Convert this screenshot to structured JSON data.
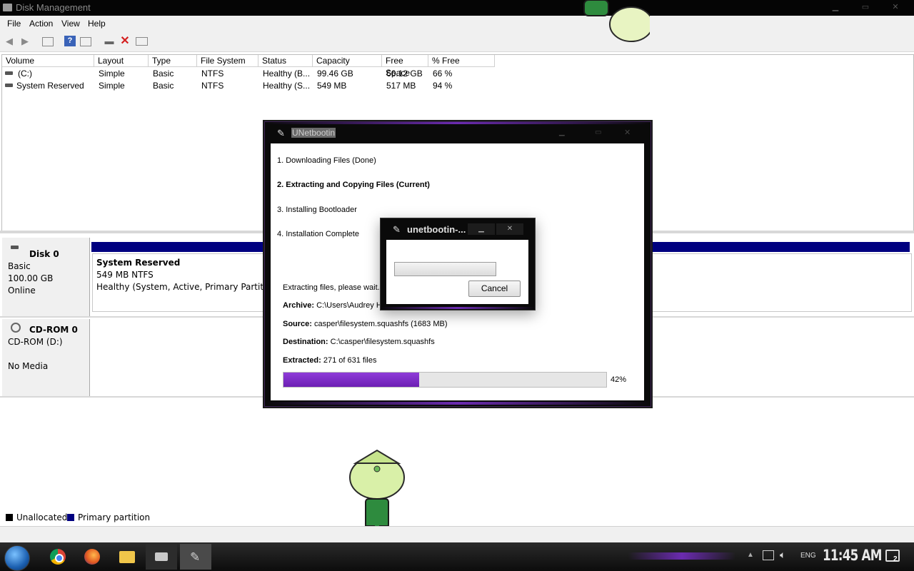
{
  "app": {
    "title": "Disk Management"
  },
  "menu": [
    "File",
    "Action",
    "View",
    "Help"
  ],
  "volumes": {
    "columns": [
      "Volume",
      "Layout",
      "Type",
      "File System",
      "Status",
      "Capacity",
      "Free Space",
      "% Free"
    ],
    "rows": [
      [
        "(C:)",
        "Simple",
        "Basic",
        "NTFS",
        "Healthy (B...",
        "99.46 GB",
        "66.12 GB",
        "66 %"
      ],
      [
        "System Reserved",
        "Simple",
        "Basic",
        "NTFS",
        "Healthy (S...",
        "549 MB",
        "517 MB",
        "94 %"
      ]
    ]
  },
  "disks": {
    "disk0": {
      "name": "Disk 0",
      "type": "Basic",
      "size": "100.00 GB",
      "state": "Online",
      "partition": {
        "name": "System Reserved",
        "size_fs": "549 MB NTFS",
        "status": "Healthy (System, Active, Primary Partition"
      }
    },
    "cdrom0": {
      "name": "CD-ROM 0",
      "drive": "CD-ROM (D:)",
      "media": "No Media"
    }
  },
  "legend": {
    "unallocated": "Unallocated",
    "primary": "Primary partition",
    "colors": {
      "unallocated": "#000000",
      "primary": "#000080"
    }
  },
  "unetbootin": {
    "title": "UNetbootin",
    "steps": [
      "1. Downloading Files (Done)",
      "2. Extracting and Copying Files (Current)",
      "3. Installing Bootloader",
      "4. Installation Complete"
    ],
    "status": "Extracting files, please wait...",
    "archive_label": "Archive:",
    "archive": "C:\\Users\\Audrey H",
    "source_label": "Source:",
    "source": "casper\\filesystem.squashfs (1683 MB)",
    "destination_label": "Destination:",
    "destination": "C:\\casper\\filesystem.squashfs",
    "extracted_label": "Extracted:",
    "extracted": "271 of 631 files",
    "progress": 0.42,
    "progress_text": "42%",
    "accent": "#7a2ac4"
  },
  "small_dialog": {
    "title": "unetbootin-...",
    "cancel": "Cancel"
  },
  "taskbar": {
    "apps": [
      "start-orb-icon",
      "chrome-icon",
      "firefox-icon",
      "folder-icon",
      "disk-management-icon",
      "unetbootin-icon"
    ],
    "lang": "ENG",
    "clock": "11:45 AM",
    "notifications": "2"
  }
}
